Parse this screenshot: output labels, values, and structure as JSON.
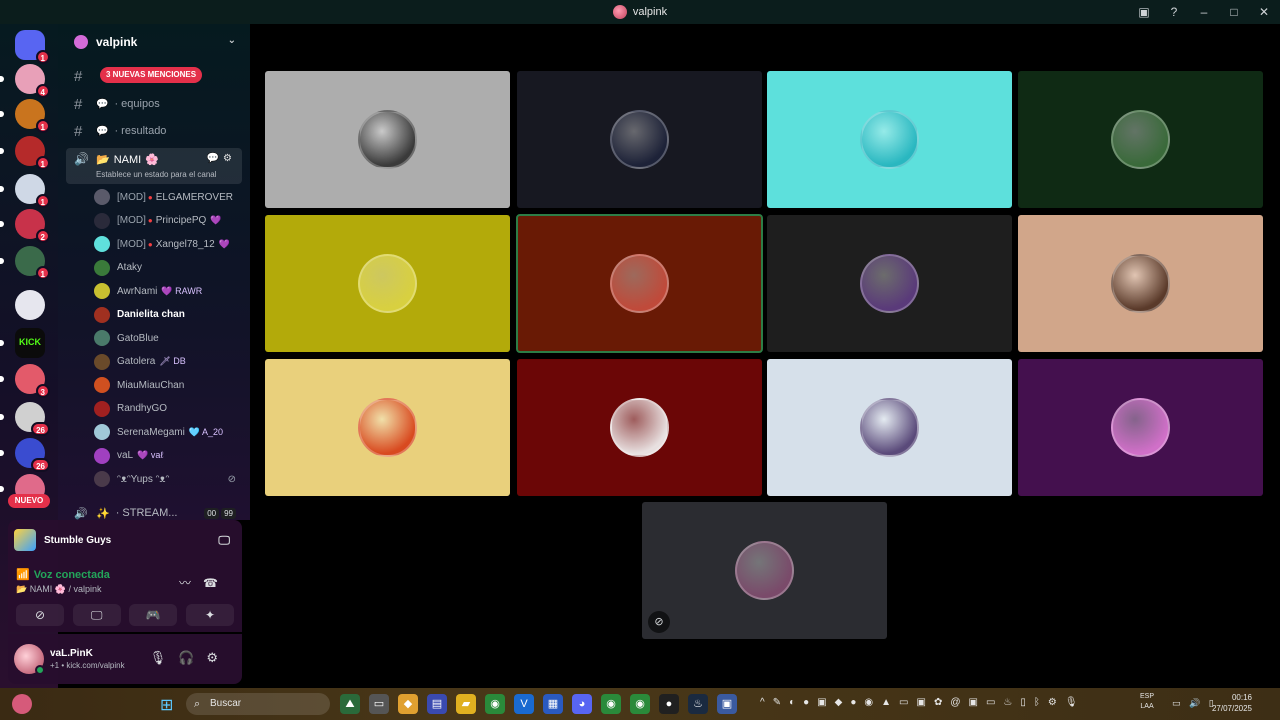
{
  "window": {
    "title": "valpink"
  },
  "servers": [
    {
      "badge": "1",
      "color": "#5865f2",
      "icon": "discord-icon"
    },
    {
      "badge": "4",
      "color": "#e8a0b8"
    },
    {
      "badge": "1",
      "color": "#c9741e"
    },
    {
      "badge": "1",
      "color": "#b52a2a"
    },
    {
      "badge": "1",
      "color": "#cfd8e6"
    },
    {
      "badge": "2",
      "color": "#c8324a"
    },
    {
      "badge": "1",
      "color": "#3a6a4a"
    },
    {
      "badge": "",
      "color": "#e6e6ee"
    },
    {
      "badge": "",
      "color": "#0b0b0b",
      "label": "KICK"
    },
    {
      "badge": "3",
      "color": "#e35a6a"
    },
    {
      "badge": "26",
      "color": "#d0d0d0"
    },
    {
      "badge": "26",
      "color": "#3a4cd0"
    },
    {
      "badge": "",
      "color": "#e06a8a"
    }
  ],
  "new_label": "NUEVO",
  "guild": {
    "name": "valpink"
  },
  "channels": {
    "mentions_label": "3 NUEVAS MENCIONES",
    "text": [
      {
        "label": "· equipos"
      },
      {
        "label": "· resultado"
      }
    ],
    "active_voice": {
      "name": "NAMI",
      "status": "Establece un estado para el canal"
    },
    "members": [
      {
        "mod": "[MOD]",
        "name": "ELGAMEROVER",
        "tag": "",
        "bold": false,
        "color": "#5a5a6a"
      },
      {
        "mod": "[MOD]",
        "name": "PrincipePQ",
        "tag": "💜",
        "bold": false,
        "color": "#2a2a3a"
      },
      {
        "mod": "[MOD]",
        "name": "Xangel78_12",
        "tag": "💜",
        "bold": false,
        "color": "#5fe0dc"
      },
      {
        "mod": "",
        "name": "Ataky",
        "tag": "",
        "bold": false,
        "color": "#3a7a3a"
      },
      {
        "mod": "",
        "name": "AwrNami",
        "tag": "💜 RAWR",
        "bold": false,
        "color": "#c8c030"
      },
      {
        "mod": "",
        "name": "Danielita chan",
        "tag": "",
        "bold": true,
        "color": "#a03020"
      },
      {
        "mod": "",
        "name": "GatoBlue",
        "tag": "",
        "bold": false,
        "color": "#4a7a6a"
      },
      {
        "mod": "",
        "name": "Gatolera",
        "tag": "🗡 DB",
        "bold": false,
        "color": "#6a4a2a"
      },
      {
        "mod": "",
        "name": "MiauMiauChan",
        "tag": "",
        "bold": false,
        "color": "#d05020"
      },
      {
        "mod": "",
        "name": "RandhyGO",
        "tag": "",
        "bold": false,
        "color": "#a02020"
      },
      {
        "mod": "",
        "name": "SerenaMegami",
        "tag": "🩵 A_20",
        "bold": false,
        "color": "#a0c8d8"
      },
      {
        "mod": "",
        "name": "vaL",
        "tag": "💜 vaℓ",
        "bold": false,
        "color": "#a040c0"
      },
      {
        "mod": "",
        "name": "ᵔᴥᵔYups ᵔᴥᵔ",
        "tag": "",
        "bold": false,
        "color": "#4a3a4a"
      }
    ],
    "stream_channel": {
      "name": "· STREAM...",
      "count_a": "00",
      "count_b": "99"
    }
  },
  "activity": {
    "game": "Stumble Guys"
  },
  "voice_panel": {
    "status": "Voz conectada",
    "location": "NAMI",
    "location_suffix": "/ valpink"
  },
  "user": {
    "name": "vaL.PinK",
    "subtitle": "+1 • kick.com/valpink"
  },
  "tiles": [
    {
      "bg": "#adadad",
      "avatar": "#3a3a3a",
      "speaking": false
    },
    {
      "bg": "#171821",
      "avatar": "#1d2238",
      "speaking": false
    },
    {
      "bg": "#5de0dc",
      "avatar": "#2ab7c0",
      "speaking": false
    },
    {
      "bg": "#0f2a14",
      "avatar": "#3a6a3a",
      "speaking": false
    },
    {
      "bg": "#b3aa0a",
      "avatar": "#d8d040",
      "speaking": false
    },
    {
      "bg": "#691a05",
      "avatar": "#c04a3a",
      "speaking": true
    },
    {
      "bg": "#1e1e1e",
      "avatar": "#5a3a7a",
      "speaking": false
    },
    {
      "bg": "#d1a68a",
      "avatar": "#5a3a2a",
      "speaking": false
    },
    {
      "bg": "#e9d07c",
      "avatar": "#d84a20",
      "speaking": false
    },
    {
      "bg": "#6b0606",
      "avatar": "#e8e0e0",
      "speaking": false
    },
    {
      "bg": "#d6e0ea",
      "avatar": "#5a4a7a",
      "speaking": false
    },
    {
      "bg": "#44104e",
      "avatar": "#d070c8",
      "speaking": false
    },
    {
      "bg": "#2b2c31",
      "avatar": "#7a4a6a",
      "speaking": false,
      "muted": true
    }
  ],
  "taskbar": {
    "search_placeholder": "Buscar",
    "lang_top": "ESP",
    "lang_bottom": "LAA",
    "time": "00:16",
    "date": "27/07/2025"
  }
}
